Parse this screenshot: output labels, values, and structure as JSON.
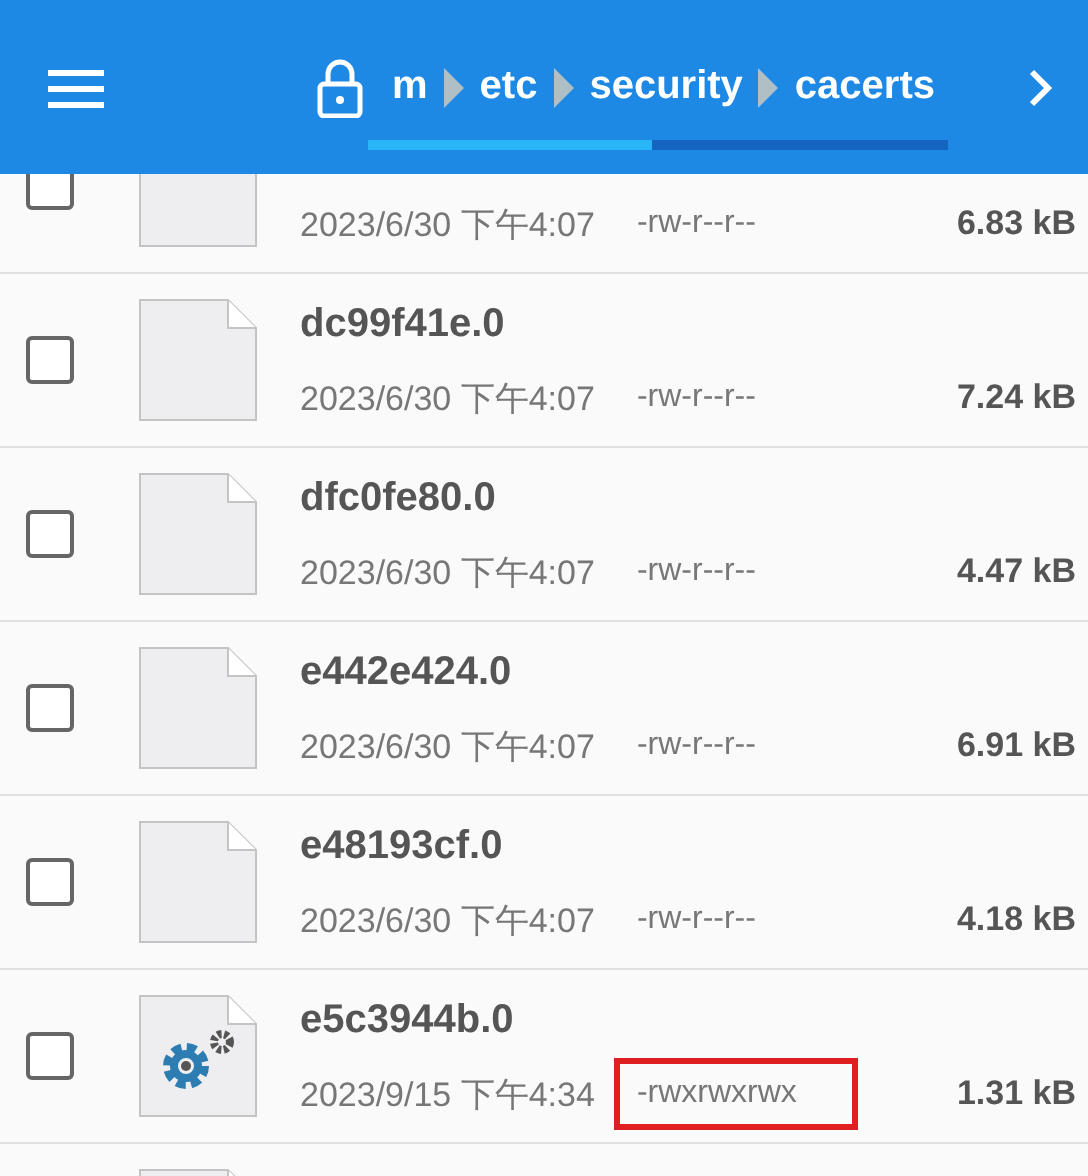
{
  "toolbar": {
    "breadcrumbs": [
      "m",
      "etc",
      "security",
      "cacerts"
    ]
  },
  "files": [
    {
      "kind": "file",
      "checked": false,
      "date": "2023/6/30 下午4:07",
      "permissions": "-rw-r--r--",
      "size": "6.83 kB",
      "highlighted": false
    },
    {
      "kind": "file",
      "checked": false,
      "name": "dc99f41e.0",
      "date": "2023/6/30 下午4:07",
      "permissions": "-rw-r--r--",
      "size": "7.24 kB",
      "highlighted": false
    },
    {
      "kind": "file",
      "checked": false,
      "name": "dfc0fe80.0",
      "date": "2023/6/30 下午4:07",
      "permissions": "-rw-r--r--",
      "size": "4.47 kB",
      "highlighted": false
    },
    {
      "kind": "file",
      "checked": false,
      "name": "e442e424.0",
      "date": "2023/6/30 下午4:07",
      "permissions": "-rw-r--r--",
      "size": "6.91 kB",
      "highlighted": false
    },
    {
      "kind": "file",
      "checked": false,
      "name": "e48193cf.0",
      "date": "2023/6/30 下午4:07",
      "permissions": "-rw-r--r--",
      "size": "4.18 kB",
      "highlighted": false
    },
    {
      "kind": "settings",
      "checked": false,
      "name": "e5c3944b.0",
      "date": "2023/9/15 下午4:34",
      "permissions": "-rwxrwxrwx",
      "size": "1.31 kB",
      "highlighted": true
    },
    {
      "kind": "file"
    }
  ]
}
